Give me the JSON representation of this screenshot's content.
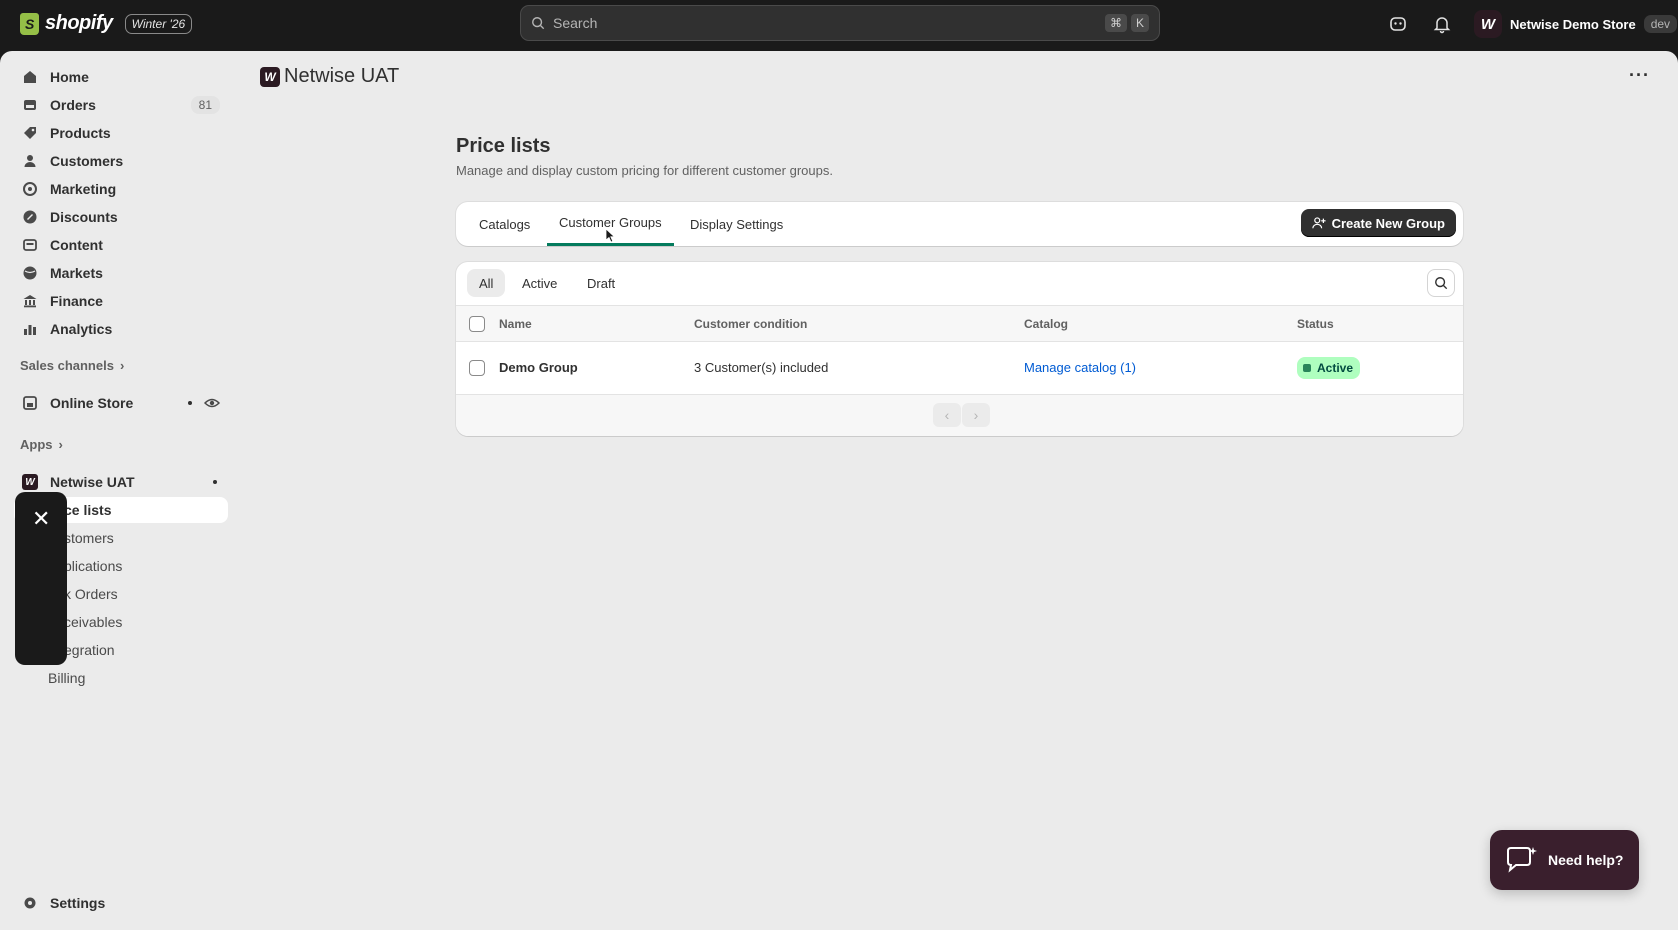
{
  "topbar": {
    "brand": "shopify",
    "edition": "Winter '26",
    "search_placeholder": "Search",
    "shortcut_keys": [
      "⌘",
      "K"
    ],
    "store_initial": "W",
    "store_name": "Netwise Demo Store",
    "store_env": "dev"
  },
  "sidebar": {
    "items": [
      {
        "label": "Home",
        "icon": "home-icon"
      },
      {
        "label": "Orders",
        "icon": "orders-icon",
        "count": "81"
      },
      {
        "label": "Products",
        "icon": "tag-icon"
      },
      {
        "label": "Customers",
        "icon": "person-icon"
      },
      {
        "label": "Marketing",
        "icon": "target-icon"
      },
      {
        "label": "Discounts",
        "icon": "discount-icon"
      },
      {
        "label": "Content",
        "icon": "content-icon"
      },
      {
        "label": "Markets",
        "icon": "globe-icon"
      },
      {
        "label": "Finance",
        "icon": "bank-icon"
      },
      {
        "label": "Analytics",
        "icon": "chart-icon"
      }
    ],
    "sales_channels_label": "Sales channels",
    "online_store_label": "Online Store",
    "apps_label": "Apps",
    "app_name": "Netwise UAT",
    "app_subitems": [
      "ce lists",
      "stomers",
      "plications",
      "k Orders",
      "ceivables",
      "egration",
      "Billing"
    ],
    "settings_label": "Settings"
  },
  "main": {
    "app_initial": "W",
    "app_title": "Netwise UAT",
    "more_label": "···",
    "page_title": "Price lists",
    "page_description": "Manage and display custom pricing for different customer groups.",
    "tabs": [
      "Catalogs",
      "Customer Groups",
      "Display Settings"
    ],
    "selected_tab": "Customer Groups",
    "create_button": "Create New Group",
    "filters": [
      "All",
      "Active",
      "Draft"
    ],
    "columns": [
      "Name",
      "Customer condition",
      "Catalog",
      "Status"
    ],
    "rows": [
      {
        "name": "Demo Group",
        "condition": "3 Customer(s) included",
        "catalog": "Manage catalog (1)",
        "status": "Active"
      }
    ]
  },
  "help": {
    "label": "Need help?"
  },
  "colors": {
    "accent": "#047b5d",
    "link": "#005bd3",
    "status_bg": "#affebf",
    "topbar": "#1a1a1a"
  }
}
